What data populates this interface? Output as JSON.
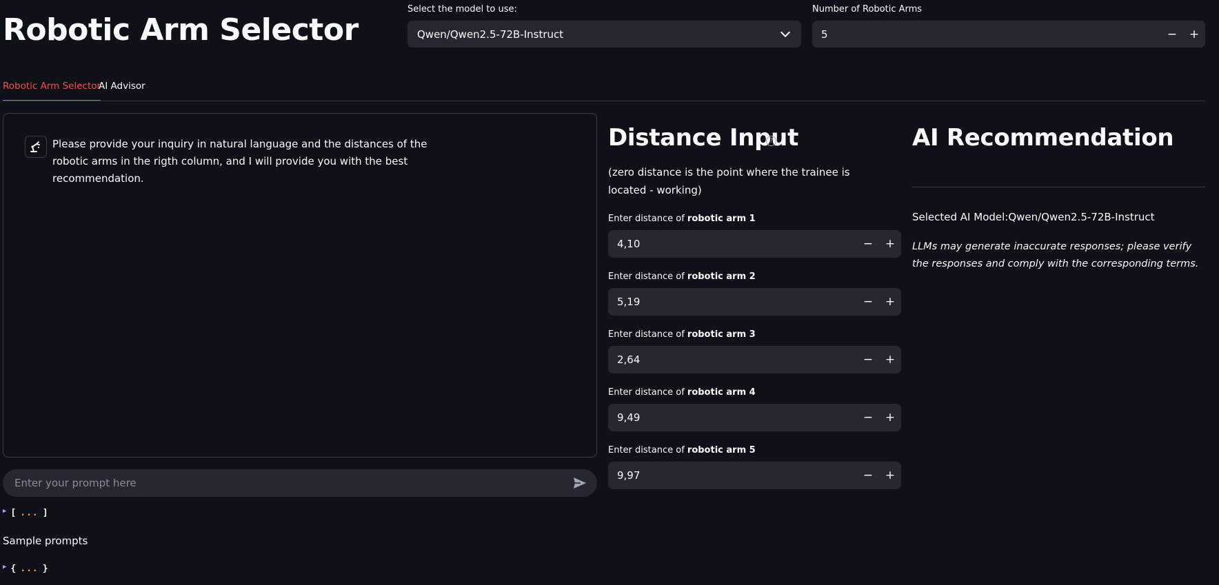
{
  "header": {
    "title": "Robotic Arm Selector",
    "model_select_label": "Select the model to use:",
    "model_selected": "Qwen/Qwen2.5-72B-Instruct",
    "arms_count_label": "Number of Robotic Arms",
    "arms_count_value": "5"
  },
  "tabs": [
    {
      "label": "Robotic Arm Selector",
      "active": true
    },
    {
      "label": "AI Advisor",
      "active": false
    }
  ],
  "chat": {
    "assistant_message": "Please provide your inquiry in natural language and the distances of the robotic arms in the rigth column, and I will provide you with the best recommendation.",
    "input_placeholder": "Enter your prompt here"
  },
  "json_widgets": {
    "array_open": "[",
    "array_close": "]",
    "object_open": "{",
    "object_close": "}",
    "ellipsis": "..."
  },
  "sample_prompts_label": "Sample prompts",
  "distance_input": {
    "title": "Distance Input",
    "help_icon": "question-circle-icon",
    "subtitle": "(zero distance is the point where the trainee is located - working)",
    "label_prefix": "Enter distance of ",
    "arms": [
      {
        "name": "robotic arm 1",
        "value": "4,10"
      },
      {
        "name": "robotic arm 2",
        "value": "5,19"
      },
      {
        "name": "robotic arm 3",
        "value": "2,64"
      },
      {
        "name": "robotic arm 4",
        "value": "9,49"
      },
      {
        "name": "robotic arm 5",
        "value": "9,97"
      }
    ],
    "minus": "−",
    "plus": "+"
  },
  "recommendation": {
    "title": "AI Recommendation",
    "selected_model": "Selected AI Model:Qwen/Qwen2.5-72B-Instruct",
    "disclaimer": "LLMs may generate inaccurate responses; please verify the responses and comply with the corresponding terms."
  },
  "colors": {
    "background": "#0e1117",
    "input_bg": "#262730",
    "accent": "#ff4b4b"
  }
}
